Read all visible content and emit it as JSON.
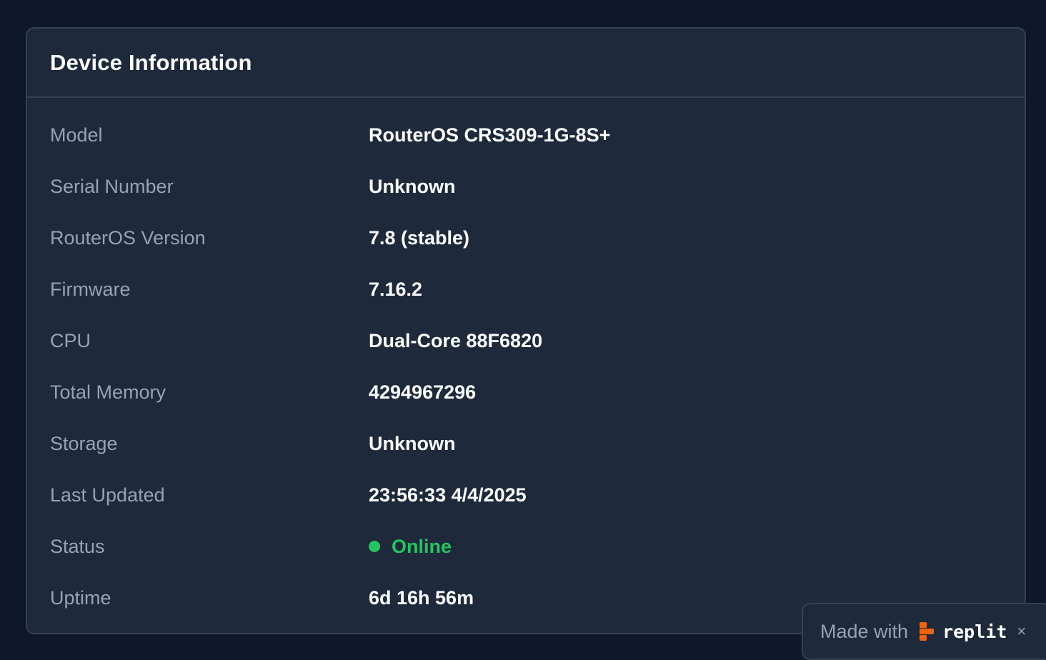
{
  "card": {
    "title": "Device Information"
  },
  "rows": [
    {
      "label": "Model",
      "value": "RouterOS CRS309-1G-8S+"
    },
    {
      "label": "Serial Number",
      "value": "Unknown"
    },
    {
      "label": "RouterOS Version",
      "value": "7.8 (stable)"
    },
    {
      "label": "Firmware",
      "value": "7.16.2"
    },
    {
      "label": "CPU",
      "value": "Dual-Core 88F6820"
    },
    {
      "label": "Total Memory",
      "value": "4294967296"
    },
    {
      "label": "Storage",
      "value": "Unknown"
    },
    {
      "label": "Last Updated",
      "value": "23:56:33 4/4/2025"
    },
    {
      "label": "Status",
      "value": "Online",
      "status_color": "#22c55e"
    },
    {
      "label": "Uptime",
      "value": "6d 16h 56m"
    }
  ],
  "badge": {
    "text": "Made with",
    "brand": "replit",
    "close": "×",
    "brand_color": "#f26207"
  }
}
